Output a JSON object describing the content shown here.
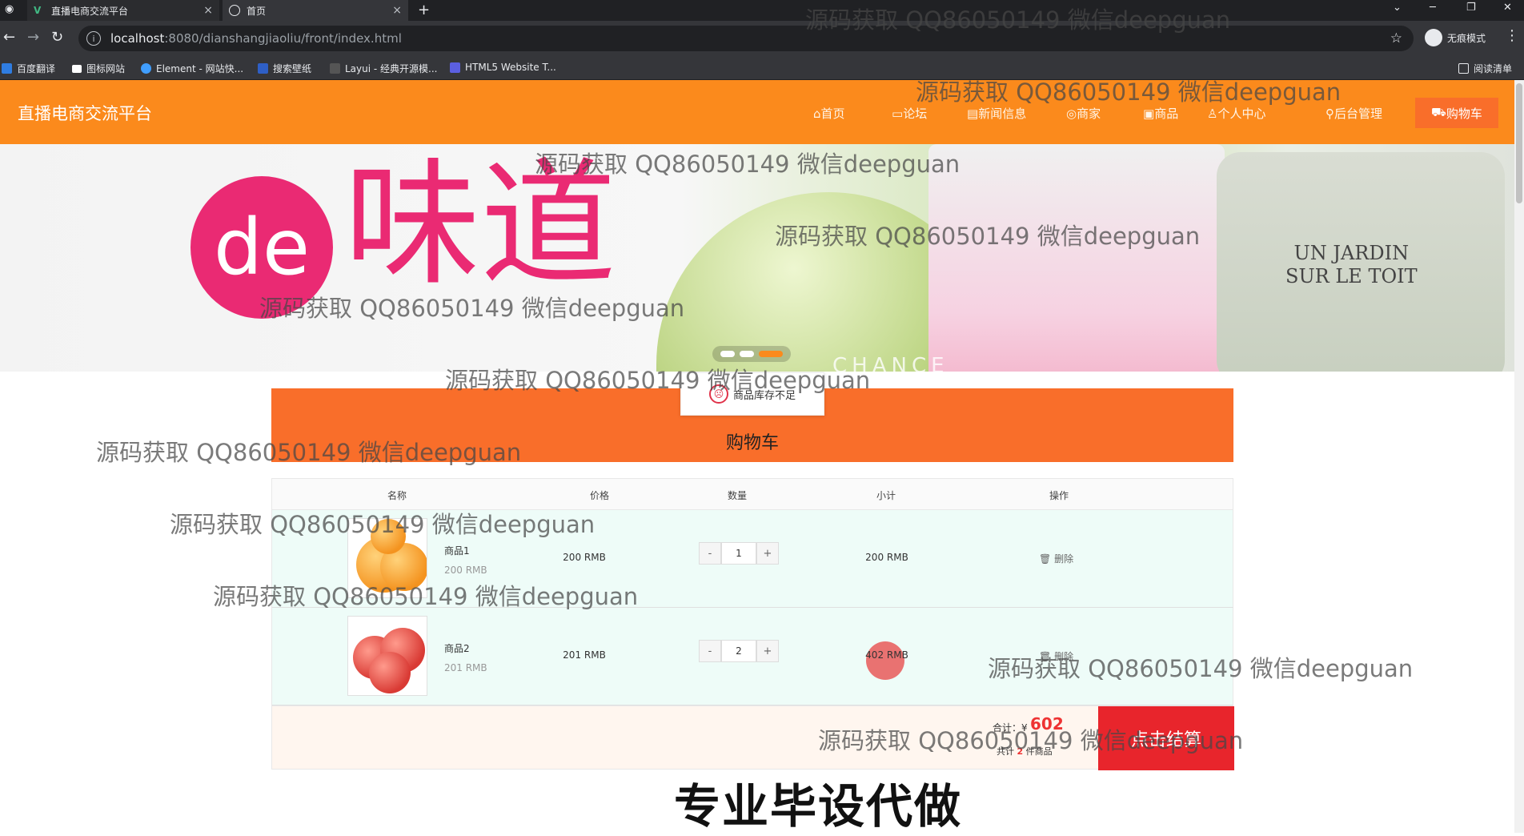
{
  "browser": {
    "tab1_title": "直播电商交流平台",
    "tab2_title": "首页",
    "url_host": "localhost",
    "url_path": ":8080/dianshangjiaoliu/front/index.html",
    "incognito_label": "无痕模式",
    "bookmarks": [
      "百度翻译",
      "图标网站",
      "Element - 网站快...",
      "搜索壁纸",
      "Layui - 经典开源模...",
      "HTML5 Website T..."
    ],
    "reading_list": "阅读清单"
  },
  "site": {
    "logo": "直播电商交流平台",
    "nav": [
      "首页",
      "论坛",
      "新闻信息",
      "商家",
      "商品",
      "个人中心",
      "后台管理"
    ],
    "cart": "购物车"
  },
  "banner": {
    "de": "de",
    "word": "味道",
    "label": "UN JARDIN\nSUR LE TOIT",
    "chance": "CHANCE",
    "slide_count": 3,
    "active_slide": 3
  },
  "toast": {
    "message": "商品库存不足"
  },
  "cart": {
    "title": "购物车",
    "columns": [
      "名称",
      "价格",
      "数量",
      "小计",
      "操作"
    ],
    "items": [
      {
        "name": "商品1",
        "unit": "200 RMB",
        "price": "200 RMB",
        "qty": "1",
        "subtotal": "200 RMB",
        "action": "删除"
      },
      {
        "name": "商品2",
        "unit": "201 RMB",
        "price": "201 RMB",
        "qty": "2",
        "subtotal": "402 RMB",
        "action": "删除"
      }
    ],
    "total_label": "合计：¥",
    "total": "602",
    "count_prefix": "共计",
    "count": "2",
    "count_suffix": "件商品",
    "checkout": "点击结算",
    "minus": "-",
    "plus": "+"
  },
  "overlay": {
    "watermark": "源码获取 QQ86050149 微信deepguan",
    "bottom_text": "专业毕设代做"
  }
}
